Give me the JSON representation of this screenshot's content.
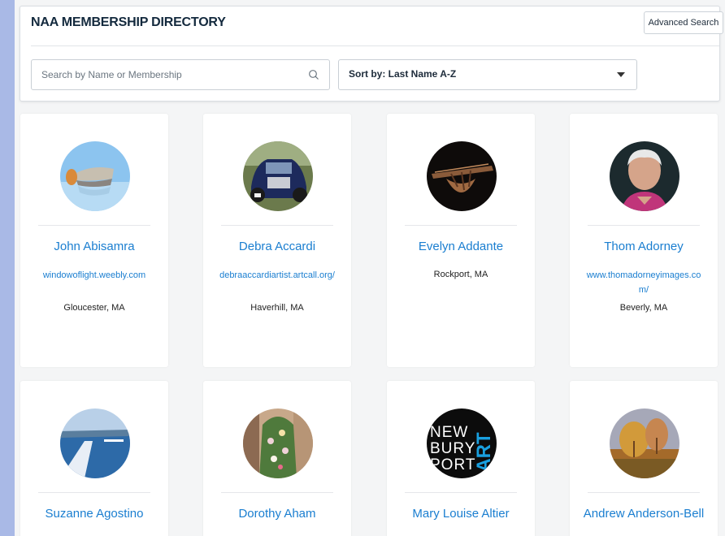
{
  "header": {
    "title": "NAA MEMBERSHIP DIRECTORY",
    "advanced_search": "Advanced Search",
    "search_placeholder": "Search by Name or Membership",
    "sort_label": "Sort by: Last Name A-Z"
  },
  "members": [
    {
      "name": "John Abisamra",
      "website": "windowoflight.weebly.com",
      "location": "Gloucester, MA"
    },
    {
      "name": "Debra Accardi",
      "website": "debraaccardiartist.artcall.org/",
      "location": "Haverhill, MA"
    },
    {
      "name": "Evelyn Addante",
      "website": "",
      "location": "Rockport, MA"
    },
    {
      "name": "Thom Adorney",
      "website": "www.thomadorneyimages.com/",
      "location": "Beverly, MA"
    },
    {
      "name": "Suzanne Agostino"
    },
    {
      "name": "Dorothy Aham"
    },
    {
      "name": "Mary Louise Altier"
    },
    {
      "name": "Andrew Anderson-Bell"
    }
  ],
  "logo_text": {
    "line1": "NEW",
    "line2": "BURY",
    "line3": "PORT",
    "vertical": "ART"
  },
  "colors": {
    "accent": "#1a7ed0",
    "title": "#13293d",
    "background": "#a9b9e6"
  }
}
